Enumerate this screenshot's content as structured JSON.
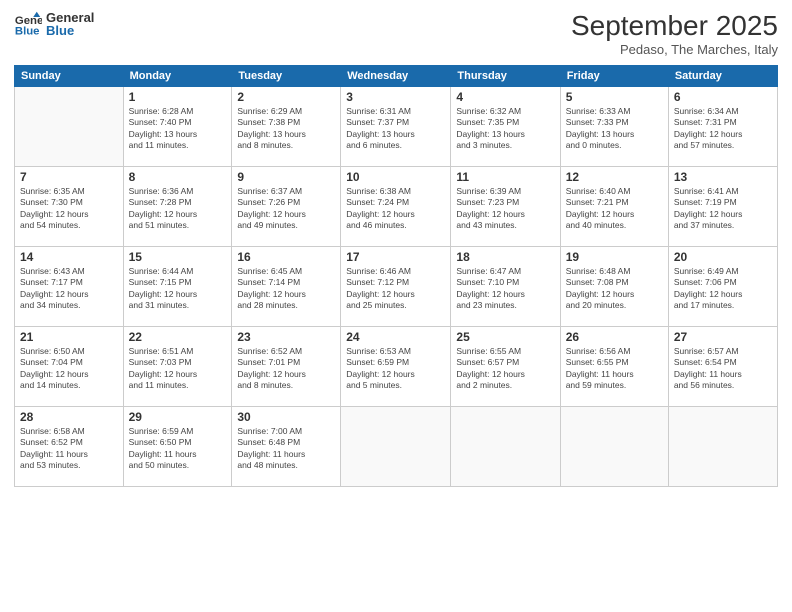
{
  "logo": {
    "line1": "General",
    "line2": "Blue"
  },
  "header": {
    "month": "September 2025",
    "location": "Pedaso, The Marches, Italy"
  },
  "weekdays": [
    "Sunday",
    "Monday",
    "Tuesday",
    "Wednesday",
    "Thursday",
    "Friday",
    "Saturday"
  ],
  "weeks": [
    [
      {
        "day": "",
        "info": ""
      },
      {
        "day": "1",
        "info": "Sunrise: 6:28 AM\nSunset: 7:40 PM\nDaylight: 13 hours\nand 11 minutes."
      },
      {
        "day": "2",
        "info": "Sunrise: 6:29 AM\nSunset: 7:38 PM\nDaylight: 13 hours\nand 8 minutes."
      },
      {
        "day": "3",
        "info": "Sunrise: 6:31 AM\nSunset: 7:37 PM\nDaylight: 13 hours\nand 6 minutes."
      },
      {
        "day": "4",
        "info": "Sunrise: 6:32 AM\nSunset: 7:35 PM\nDaylight: 13 hours\nand 3 minutes."
      },
      {
        "day": "5",
        "info": "Sunrise: 6:33 AM\nSunset: 7:33 PM\nDaylight: 13 hours\nand 0 minutes."
      },
      {
        "day": "6",
        "info": "Sunrise: 6:34 AM\nSunset: 7:31 PM\nDaylight: 12 hours\nand 57 minutes."
      }
    ],
    [
      {
        "day": "7",
        "info": "Sunrise: 6:35 AM\nSunset: 7:30 PM\nDaylight: 12 hours\nand 54 minutes."
      },
      {
        "day": "8",
        "info": "Sunrise: 6:36 AM\nSunset: 7:28 PM\nDaylight: 12 hours\nand 51 minutes."
      },
      {
        "day": "9",
        "info": "Sunrise: 6:37 AM\nSunset: 7:26 PM\nDaylight: 12 hours\nand 49 minutes."
      },
      {
        "day": "10",
        "info": "Sunrise: 6:38 AM\nSunset: 7:24 PM\nDaylight: 12 hours\nand 46 minutes."
      },
      {
        "day": "11",
        "info": "Sunrise: 6:39 AM\nSunset: 7:23 PM\nDaylight: 12 hours\nand 43 minutes."
      },
      {
        "day": "12",
        "info": "Sunrise: 6:40 AM\nSunset: 7:21 PM\nDaylight: 12 hours\nand 40 minutes."
      },
      {
        "day": "13",
        "info": "Sunrise: 6:41 AM\nSunset: 7:19 PM\nDaylight: 12 hours\nand 37 minutes."
      }
    ],
    [
      {
        "day": "14",
        "info": "Sunrise: 6:43 AM\nSunset: 7:17 PM\nDaylight: 12 hours\nand 34 minutes."
      },
      {
        "day": "15",
        "info": "Sunrise: 6:44 AM\nSunset: 7:15 PM\nDaylight: 12 hours\nand 31 minutes."
      },
      {
        "day": "16",
        "info": "Sunrise: 6:45 AM\nSunset: 7:14 PM\nDaylight: 12 hours\nand 28 minutes."
      },
      {
        "day": "17",
        "info": "Sunrise: 6:46 AM\nSunset: 7:12 PM\nDaylight: 12 hours\nand 25 minutes."
      },
      {
        "day": "18",
        "info": "Sunrise: 6:47 AM\nSunset: 7:10 PM\nDaylight: 12 hours\nand 23 minutes."
      },
      {
        "day": "19",
        "info": "Sunrise: 6:48 AM\nSunset: 7:08 PM\nDaylight: 12 hours\nand 20 minutes."
      },
      {
        "day": "20",
        "info": "Sunrise: 6:49 AM\nSunset: 7:06 PM\nDaylight: 12 hours\nand 17 minutes."
      }
    ],
    [
      {
        "day": "21",
        "info": "Sunrise: 6:50 AM\nSunset: 7:04 PM\nDaylight: 12 hours\nand 14 minutes."
      },
      {
        "day": "22",
        "info": "Sunrise: 6:51 AM\nSunset: 7:03 PM\nDaylight: 12 hours\nand 11 minutes."
      },
      {
        "day": "23",
        "info": "Sunrise: 6:52 AM\nSunset: 7:01 PM\nDaylight: 12 hours\nand 8 minutes."
      },
      {
        "day": "24",
        "info": "Sunrise: 6:53 AM\nSunset: 6:59 PM\nDaylight: 12 hours\nand 5 minutes."
      },
      {
        "day": "25",
        "info": "Sunrise: 6:55 AM\nSunset: 6:57 PM\nDaylight: 12 hours\nand 2 minutes."
      },
      {
        "day": "26",
        "info": "Sunrise: 6:56 AM\nSunset: 6:55 PM\nDaylight: 11 hours\nand 59 minutes."
      },
      {
        "day": "27",
        "info": "Sunrise: 6:57 AM\nSunset: 6:54 PM\nDaylight: 11 hours\nand 56 minutes."
      }
    ],
    [
      {
        "day": "28",
        "info": "Sunrise: 6:58 AM\nSunset: 6:52 PM\nDaylight: 11 hours\nand 53 minutes."
      },
      {
        "day": "29",
        "info": "Sunrise: 6:59 AM\nSunset: 6:50 PM\nDaylight: 11 hours\nand 50 minutes."
      },
      {
        "day": "30",
        "info": "Sunrise: 7:00 AM\nSunset: 6:48 PM\nDaylight: 11 hours\nand 48 minutes."
      },
      {
        "day": "",
        "info": ""
      },
      {
        "day": "",
        "info": ""
      },
      {
        "day": "",
        "info": ""
      },
      {
        "day": "",
        "info": ""
      }
    ]
  ]
}
